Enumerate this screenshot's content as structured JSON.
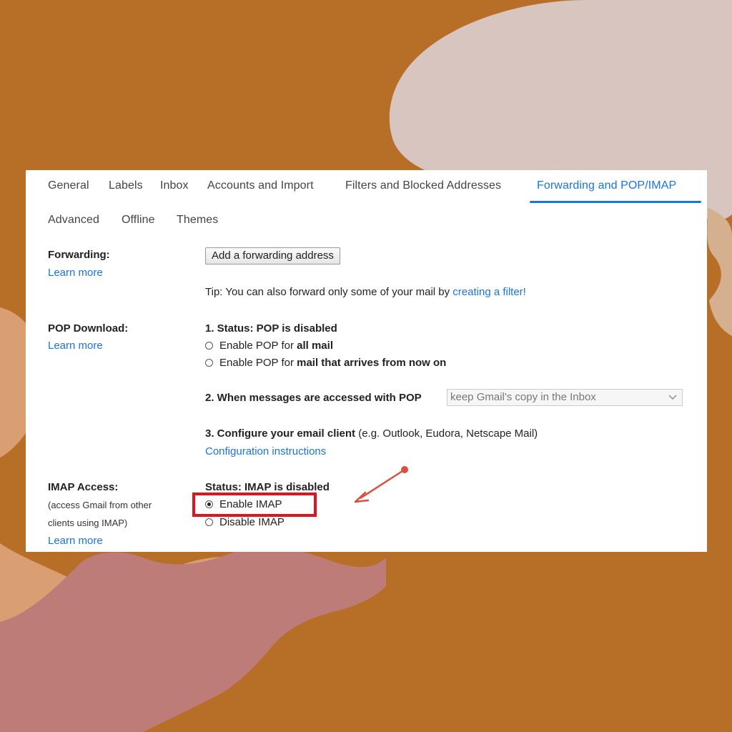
{
  "colors": {
    "background": "#b76e27",
    "accent": "#1a73e8",
    "highlight": "#e0141a",
    "arrow": "#d9503e"
  },
  "tabs": [
    {
      "label": "General"
    },
    {
      "label": "Labels"
    },
    {
      "label": "Inbox"
    },
    {
      "label": "Accounts and Import"
    },
    {
      "label": "Filters and Blocked Addresses"
    },
    {
      "label": "Forwarding and POP/IMAP",
      "active": true
    },
    {
      "label": "Advanced"
    },
    {
      "label": "Offline"
    },
    {
      "label": "Themes"
    }
  ],
  "forwarding": {
    "label": "Forwarding:",
    "learn_more": "Learn more",
    "button": "Add a forwarding address",
    "tip_prefix": "Tip: You can also forward only some of your mail by ",
    "tip_link": "creating a filter!"
  },
  "pop": {
    "label": "POP Download:",
    "learn_more": "Learn more",
    "status": "1. Status: POP is disabled",
    "option1_prefix": "Enable POP for ",
    "option1_bold": "all mail",
    "option2_prefix": "Enable POP for ",
    "option2_bold": "mail that arrives from now on",
    "when_label": "2. When messages are accessed with POP",
    "when_value": "keep Gmail's copy in the Inbox",
    "configure_bold": "3. Configure your email client",
    "configure_rest": " (e.g. Outlook, Eudora, Netscape Mail)",
    "config_link": "Configuration instructions"
  },
  "imap": {
    "label": "IMAP Access:",
    "note_line1": "(access Gmail from other",
    "note_line2": "clients using IMAP)",
    "learn_more": "Learn more",
    "status": "Status: IMAP is disabled",
    "enable": "Enable IMAP",
    "disable": "Disable IMAP",
    "selected": "enable"
  },
  "icons": {
    "dropdown": "chevron-down-icon",
    "annotation": "arrow-icon"
  }
}
